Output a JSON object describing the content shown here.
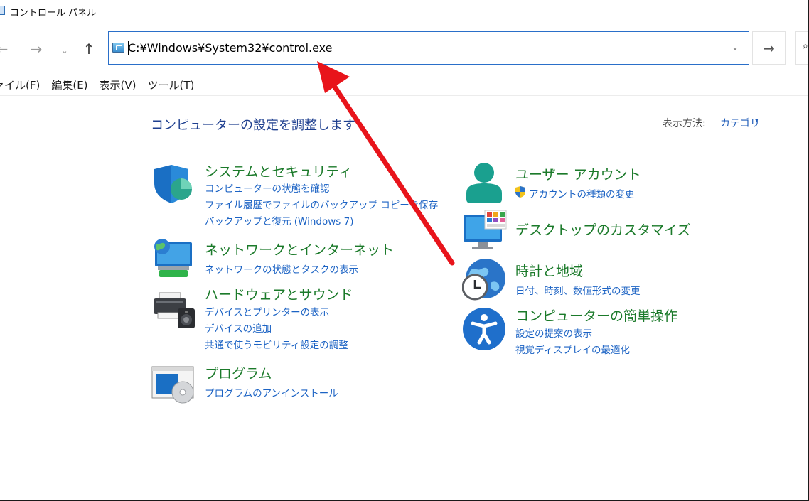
{
  "window": {
    "title": "コントロール パネル"
  },
  "nav": {
    "back_glyph": "←",
    "forward_glyph": "→",
    "recent_glyph": "⌄",
    "up_glyph": "↑",
    "go_glyph": "→"
  },
  "address": {
    "value": "C:¥Windows¥System32¥control.exe",
    "dropdown_glyph": "⌄"
  },
  "search": {
    "glyph": "⌕"
  },
  "menu": [
    "ァイル(F)",
    "編集(E)",
    "表示(V)",
    "ツール(T)"
  ],
  "main": {
    "title": "コンピューターの設定を調整します",
    "view_by_label": "表示方法:",
    "view_by_value": "カテゴリ",
    "view_by_caret": "▾"
  },
  "categories": {
    "system_security": {
      "title": "システムとセキュリティ",
      "links": [
        "コンピューターの状態を確認",
        "ファイル履歴でファイルのバックアップ コピーを保存",
        "バックアップと復元 (Windows 7)"
      ]
    },
    "network": {
      "title": "ネットワークとインターネット",
      "links": [
        "ネットワークの状態とタスクの表示"
      ]
    },
    "hardware": {
      "title": "ハードウェアとサウンド",
      "links": [
        "デバイスとプリンターの表示",
        "デバイスの追加",
        "共通で使うモビリティ設定の調整"
      ]
    },
    "programs": {
      "title": "プログラム",
      "links": [
        "プログラムのアンインストール"
      ]
    },
    "user_accounts": {
      "title": "ユーザー アカウント",
      "links": [
        "アカウントの種類の変更"
      ]
    },
    "appearance": {
      "title": "デスクトップのカスタマイズ",
      "links": []
    },
    "clock_region": {
      "title": "時計と地域",
      "links": [
        "日付、時刻、数値形式の変更"
      ]
    },
    "ease_of_access": {
      "title": "コンピューターの簡単操作",
      "links": [
        "設定の提案の表示",
        "視覚ディスプレイの最適化"
      ]
    }
  },
  "colors": {
    "category_title": "#1b7a2a",
    "link": "#1c63c4",
    "page_title": "#1e3f8f",
    "annotation_arrow": "#e8141b"
  }
}
